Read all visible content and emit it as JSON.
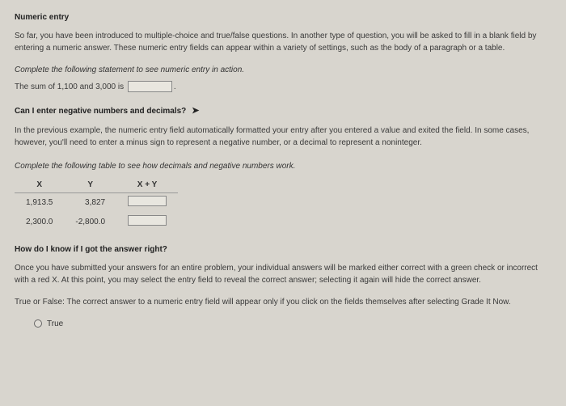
{
  "title": "Numeric entry",
  "intro": "So far, you have been introduced to multiple-choice and true/false questions. In another type of question, you will be asked to fill in a blank field by entering a numeric answer. These numeric entry fields can appear within a variety of settings, such as the body of a paragraph or a table.",
  "instruction1": "Complete the following statement to see numeric entry in action.",
  "statementPrefix": "The sum of 1,100 and 3,000 is",
  "statementSuffix": ".",
  "q1": "Can I enter negative numbers and decimals?",
  "para2": "In the previous example, the numeric entry field automatically formatted your entry after you entered a value and exited the field. In some cases, however, you'll need to enter a minus sign to represent a negative number, or a decimal to represent a noninteger.",
  "instruction2": "Complete the following table to see how decimals and negative numbers work.",
  "table": {
    "headers": [
      "X",
      "Y",
      "X + Y"
    ],
    "rows": [
      {
        "x": "1,913.5",
        "y": "3,827"
      },
      {
        "x": "2,300.0",
        "y": "-2,800.0"
      }
    ]
  },
  "q2": "How do I know if I got the answer right?",
  "para3": "Once you have submitted your answers for an entire problem, your individual answers will be marked either correct with a green check or incorrect with a red X. At this point, you may select the entry field to reveal the correct answer; selecting it again will hide the correct answer.",
  "tfPrompt": "True or False: The correct answer to a numeric entry field will appear only if you click on the fields themselves after selecting Grade It Now.",
  "trueLabel": "True"
}
